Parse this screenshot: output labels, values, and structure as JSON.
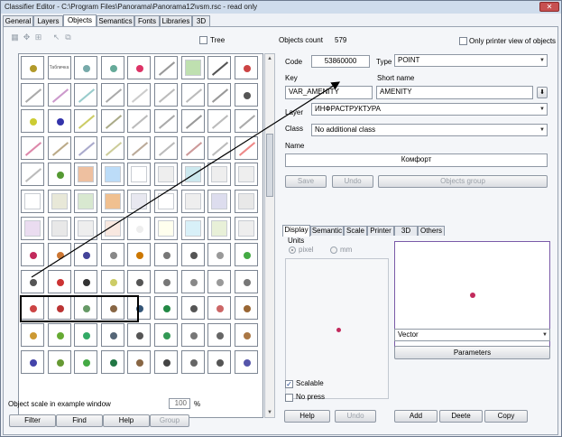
{
  "window": {
    "title": "Classifier Editor - C:\\Program Files\\Panorama\\Panorama12\\vsm.rsc - read only",
    "close_glyph": "✕"
  },
  "tabs": [
    "General",
    "Layers",
    "Objects",
    "Semantics",
    "Fonts",
    "Libraries",
    "3D"
  ],
  "active_tab": "Objects",
  "toolbar_icons": [
    "grid-icon",
    "move-icon",
    "pointer-icon",
    "copy-icon"
  ],
  "tree_label": "Tree",
  "objects_count_label": "Objects count",
  "objects_count_value": "579",
  "only_printer_label": "Only printer view of objects",
  "code_label": "Code",
  "code_value": "53860000",
  "type_label": "Type",
  "type_value": "POINT",
  "key_label": "Key",
  "short_name_label": "Short name",
  "key_value": "VAR_AMENITY",
  "short_name_value": "AMENITY",
  "layer_label": "Layer",
  "layer_value": "ИНФРАСТРУКТУРА",
  "class_label": "Class",
  "class_value": "No additional class",
  "name_label": "Name",
  "name_value": "Комфорт",
  "save_label": "Save",
  "undo_label": "Undo",
  "objects_group_label": "Objects group",
  "subtabs": [
    "Display",
    "Semantic",
    "Scale",
    "Printer",
    "3D",
    "Others"
  ],
  "units_label": "Units",
  "pixel_label": "pixel",
  "mm_label": "mm",
  "vector_value": "Vector",
  "parameters_label": "Parameters",
  "scalable_label": "Scalable",
  "no_press_label": "No press",
  "help_label": "Help",
  "undo2_label": "Undo",
  "add_label": "Add",
  "delete_label": "Deete",
  "copy_label": "Copy",
  "scale_label": "Object scale in example window",
  "scale_value": "100",
  "scale_unit": "%",
  "filter_label": "Filter",
  "find_label": "Find",
  "help_left_label": "Help",
  "group_label": "Group",
  "grid_cell_label": "Табличка",
  "colors": {
    "accent": "#c22a5c",
    "selection_frame": "#000000",
    "preview_border": "#7a5aa8"
  }
}
